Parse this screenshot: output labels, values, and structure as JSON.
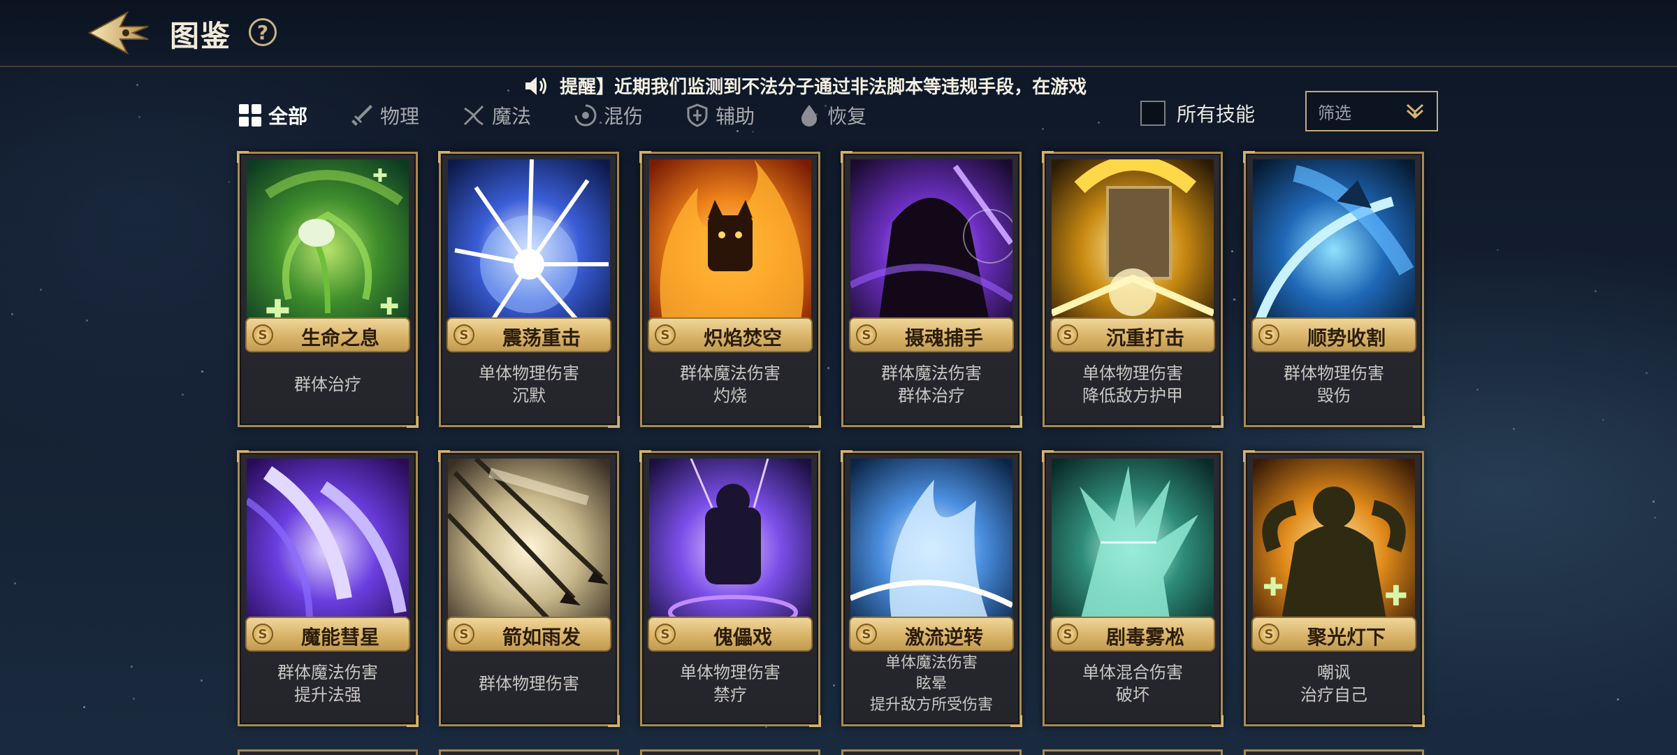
{
  "header": {
    "title": "图鉴",
    "help_symbol": "?"
  },
  "notice": {
    "text": "提醒】近期我们监测到不法分子通过非法脚本等违规手段，在游戏"
  },
  "tabs": [
    {
      "label": "全部",
      "icon": "grid-icon",
      "active": true
    },
    {
      "label": "物理",
      "icon": "sword-icon",
      "active": false
    },
    {
      "label": "魔法",
      "icon": "magic-icon",
      "active": false
    },
    {
      "label": "混伤",
      "icon": "swirl-icon",
      "active": false
    },
    {
      "label": "辅助",
      "icon": "shield-icon",
      "active": false
    },
    {
      "label": "恢复",
      "icon": "drop-icon",
      "active": false
    }
  ],
  "all_skills": {
    "label": "所有技能",
    "checked": false
  },
  "filter": {
    "label": "筛选"
  },
  "grade_badge": "S",
  "cards": [
    {
      "name": "生命之息",
      "desc": [
        "群体治疗"
      ],
      "theme": "green"
    },
    {
      "name": "震荡重击",
      "desc": [
        "单体物理伤害",
        "沉默"
      ],
      "theme": "blue-burst"
    },
    {
      "name": "炽焰焚空",
      "desc": [
        "群体魔法伤害",
        "灼烧"
      ],
      "theme": "fire"
    },
    {
      "name": "摄魂捕手",
      "desc": [
        "群体魔法伤害",
        "群体治疗"
      ],
      "theme": "purple"
    },
    {
      "name": "沉重打击",
      "desc": [
        "单体物理伤害",
        "降低敌方护甲"
      ],
      "theme": "gold"
    },
    {
      "name": "顺势收割",
      "desc": [
        "群体物理伤害",
        "毁伤"
      ],
      "theme": "ice-scythe"
    },
    {
      "name": "魔能彗星",
      "desc": [
        "群体魔法伤害",
        "提升法强"
      ],
      "theme": "violet-comet"
    },
    {
      "name": "箭如雨发",
      "desc": [
        "群体物理伤害"
      ],
      "theme": "arrows"
    },
    {
      "name": "傀儡戏",
      "desc": [
        "单体物理伤害",
        "禁疗"
      ],
      "theme": "puppet"
    },
    {
      "name": "激流逆转",
      "desc": [
        "单体魔法伤害",
        "眩晕",
        "提升敌方所受伤害"
      ],
      "theme": "water"
    },
    {
      "name": "剧毒雾凇",
      "desc": [
        "单体混合伤害",
        "破坏"
      ],
      "theme": "frost-claw"
    },
    {
      "name": "聚光灯下",
      "desc": [
        "嘲讽",
        "治疗自己"
      ],
      "theme": "golem"
    }
  ],
  "colors": {
    "gold_border": "#a88a4e",
    "plate": "#d9b468",
    "active_tab": "#ffffff",
    "inactive_tab": "#a8a9ad"
  }
}
